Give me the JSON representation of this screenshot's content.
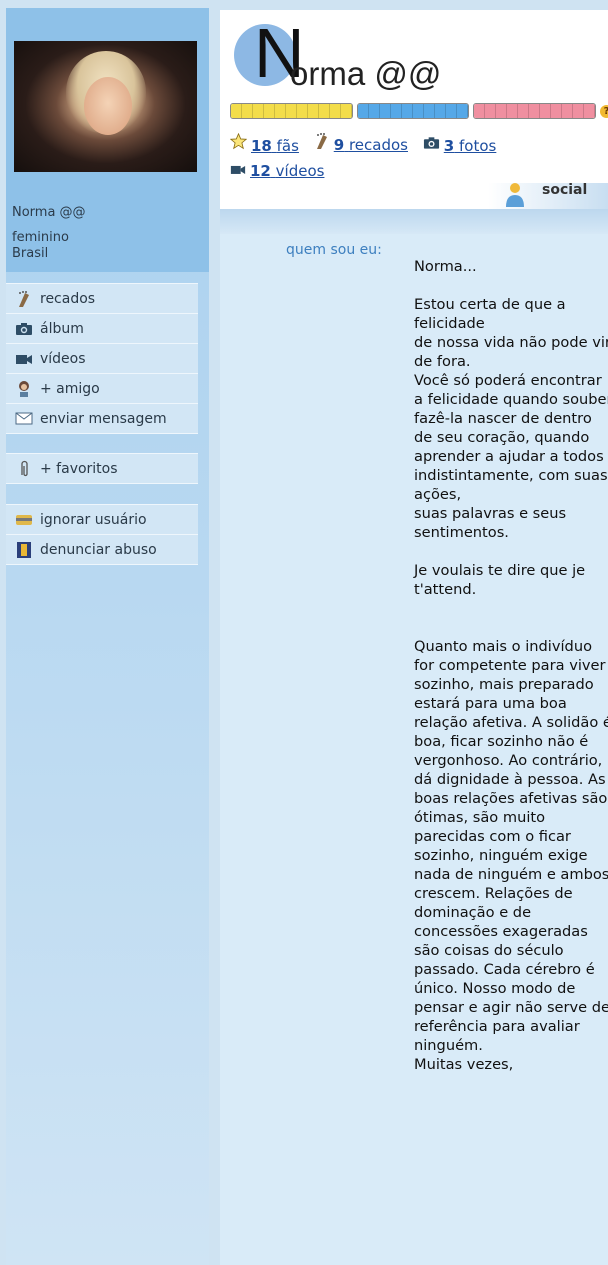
{
  "profile": {
    "name": "Norma @@",
    "gender": "feminino",
    "country": "Brasil",
    "initial": "N",
    "name_rest": "orma @@"
  },
  "sidebar": {
    "menu": [
      {
        "label": "recados",
        "icon": "scrap-icon"
      },
      {
        "label": "álbum",
        "icon": "camera-icon"
      },
      {
        "label": "vídeos",
        "icon": "video-camera-icon"
      },
      {
        "label": "+ amigo",
        "icon": "add-friend-icon"
      },
      {
        "label": "enviar mensagem",
        "icon": "envelope-icon"
      }
    ],
    "favorites_label": "+ favoritos",
    "actions": [
      {
        "label": "ignorar usuário",
        "icon": "ignore-icon"
      },
      {
        "label": "denunciar abuso",
        "icon": "report-icon"
      }
    ]
  },
  "stats": {
    "fans_count": "18",
    "fans_label": "fãs",
    "scraps_count": "9",
    "scraps_label": "recados",
    "photos_count": "3",
    "photos_label": "fotos",
    "videos_count": "12",
    "videos_label": "vídeos"
  },
  "ratings": {
    "help": "?",
    "colors": {
      "trusty": "#f3dd4a",
      "cool": "#55a8e8",
      "sexy": "#f08fa0"
    }
  },
  "tabs": {
    "social": "social"
  },
  "about": {
    "label": "quem sou eu:",
    "text": "Norma...\n\nEstou certa de que a felicidade\nde nossa vida não pode vir de fora.\nVocê só poderá encontrar a felicidade quando souber fazê-la nascer de dentro de seu coração, quando aprender a ajudar a todos\nindistintamente, com suas ações,\nsuas palavras e seus sentimentos.\n\nJe voulais te dire que je t'attend.\n\n\nQuanto mais o indivíduo for competente para viver sozinho, mais preparado estará para uma boa relação afetiva. A solidão é boa, ficar sozinho não é vergonhoso. Ao contrário, dá dignidade à pessoa. As boas relações afetivas são ótimas, são muito parecidas com o ficar sozinho, ninguém exige nada de ninguém e ambos crescem. Relações de dominação e de concessões exageradas são coisas do século passado. Cada cérebro é único. Nosso modo de pensar e agir não serve de referência para avaliar ninguém.\nMuitas vezes,"
  }
}
